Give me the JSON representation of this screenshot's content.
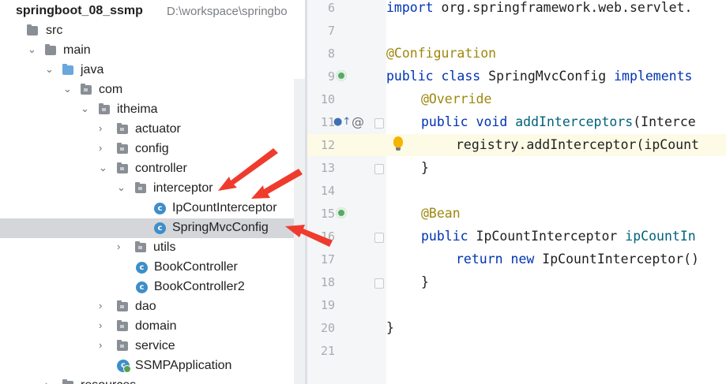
{
  "project": {
    "name": "springboot_08_ssmp",
    "path": "D:\\workspace\\springbo"
  },
  "tree": {
    "items": [
      {
        "label": "src",
        "icon": "folder-icon"
      },
      {
        "label": "main",
        "icon": "folder-icon"
      },
      {
        "label": "java",
        "icon": "source-folder-icon"
      },
      {
        "label": "com",
        "icon": "package-icon"
      },
      {
        "label": "itheima",
        "icon": "package-icon"
      },
      {
        "label": "actuator",
        "icon": "package-icon"
      },
      {
        "label": "config",
        "icon": "package-icon"
      },
      {
        "label": "controller",
        "icon": "package-icon"
      },
      {
        "label": "interceptor",
        "icon": "package-icon"
      },
      {
        "label": "IpCountInterceptor",
        "icon": "class-icon"
      },
      {
        "label": "SpringMvcConfig",
        "icon": "class-icon",
        "selected": true
      },
      {
        "label": "utils",
        "icon": "package-icon"
      },
      {
        "label": "BookController",
        "icon": "class-icon"
      },
      {
        "label": "BookController2",
        "icon": "class-icon"
      },
      {
        "label": "dao",
        "icon": "package-icon"
      },
      {
        "label": "domain",
        "icon": "package-icon"
      },
      {
        "label": "service",
        "icon": "package-icon"
      },
      {
        "label": "SSMPApplication",
        "icon": "spring-boot-class-icon"
      },
      {
        "label": "resources",
        "icon": "folder-icon"
      }
    ]
  },
  "editor": {
    "lines": [
      {
        "num": "6"
      },
      {
        "num": "7"
      },
      {
        "num": "8"
      },
      {
        "num": "9"
      },
      {
        "num": "10"
      },
      {
        "num": "11"
      },
      {
        "num": "12"
      },
      {
        "num": "13"
      },
      {
        "num": "14"
      },
      {
        "num": "15"
      },
      {
        "num": "16"
      },
      {
        "num": "17"
      },
      {
        "num": "18"
      },
      {
        "num": "19"
      },
      {
        "num": "20"
      },
      {
        "num": "21"
      }
    ],
    "tokens": {
      "l6_kw": "import",
      "l6_rest": " org.springframework.web.servlet.",
      "l8_ann": "@Configuration",
      "l9_kw": "public class",
      "l9_name": " SpringMvcConfig ",
      "l9_kw2": "implements",
      "l10_ann": "@Override",
      "l11_kw": "public void",
      "l11_sp": " ",
      "l11_mth": "addInterceptors",
      "l11_rest": "(Interce",
      "l12_text": "registry.addInterceptor(ipCount",
      "l13_text": "}",
      "l15_ann": "@Bean",
      "l16_kw": "public",
      "l16_type": " IpCountInterceptor ",
      "l16_mth": "ipCountIn",
      "l17_kw": "return new",
      "l17_rest": " IpCountInterceptor()",
      "l18_text": "}",
      "l20_text": "}",
      "l11_at": "@"
    },
    "current_line_color": "#fdfbe6"
  },
  "colors": {
    "arrow": "#ef3b2d",
    "selection": "#d4d6da",
    "keyword": "#0033b3",
    "annotation": "#9e880d",
    "method": "#00627a"
  }
}
